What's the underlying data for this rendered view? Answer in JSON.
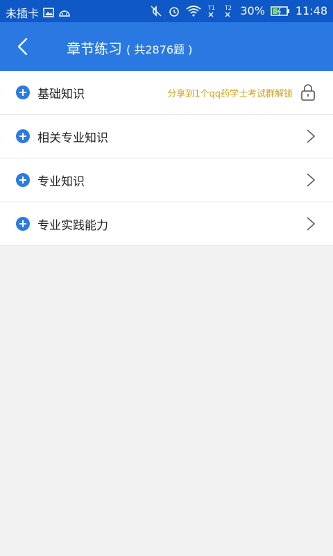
{
  "status_bar": {
    "carrier": "未插卡",
    "battery": "30%",
    "time": "11:48",
    "icons": [
      "image-icon",
      "android-icon",
      "mute-icon",
      "alarm-icon",
      "wifi-icon",
      "sim1-signal-icon",
      "sim2-signal-icon",
      "battery-icon"
    ]
  },
  "toolbar": {
    "title": "章节练习",
    "subtitle": "( 共2876题 )",
    "back_icon": "back-arrow-icon",
    "color": "#2a79e2"
  },
  "chapters": [
    {
      "label": "基础知识",
      "locked": true,
      "lock_text": "分享到1个qq药学士考试群解锁"
    },
    {
      "label": "相关专业知识",
      "locked": false
    },
    {
      "label": "专业知识",
      "locked": false
    },
    {
      "label": "专业实践能力",
      "locked": false
    }
  ],
  "colors": {
    "accent": "#2a79e2",
    "plus_icon": "#2b7be0",
    "lock_text": "#d5a11c",
    "background": "#f2f2f2"
  }
}
